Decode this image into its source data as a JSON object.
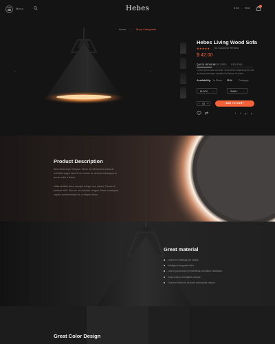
{
  "header": {
    "menu_label": "Menu",
    "brand": "Hebes",
    "links": [
      "$ EN",
      "ENG"
    ],
    "cart_icon": "bag-icon",
    "search_icon": "search-icon",
    "menu_icon": "hamburger-icon"
  },
  "breadcrumb": {
    "home": "Home",
    "separator": "—",
    "current": "Shop Categories"
  },
  "gallery": {
    "prev_icon": "arrow-left-icon",
    "next_icon": "arrow-right-icon",
    "thumbnail_count": 4
  },
  "product": {
    "title": "Hebes Living Wood Sofa",
    "stars": "★★★★★",
    "rating": 5,
    "reviews": "03 Customer Review",
    "price": "$ 42.00",
    "tabs": [
      "QUICK REVIEW",
      "FEATURES",
      "REVIEWS"
    ],
    "active_tab": 0,
    "description": "Lorem ipsum dolor sit amet, consectetur adipiscing elit, sed do eiusmod tempor incididunt ut labore et dolore.",
    "availability_label": "Availability:",
    "availability_options": [
      "In Stock",
      "SKU:",
      "Category"
    ],
    "selected_availability": 1,
    "color_select": "BLACK",
    "size_select": "SMALL",
    "qty": {
      "minus": "−",
      "value": "03",
      "plus": "+"
    },
    "add_to_cart": "ADD TO CART",
    "share_icons": [
      "f",
      "t",
      "g+",
      "p"
    ]
  },
  "description_section": {
    "title": "Product Description",
    "para1": "Sed ullamcorper tempus. Risus et velit laoreet placerat molestie augue laoreet ex cursus ut, aenean consequat ut auctor nibh a lectus.",
    "para2": "Nulla facilisis lacus suscipit integer nec rutrum. Donec id pretium nibh. Duis ac ex ut lectus congue, fusce consequat sapien cursus tempor et, ut aliquet dolor."
  },
  "material_section": {
    "title": "Great material",
    "bullets": [
      "Lorem in Chaebigs per Vitaes",
      "Intelligent integrated tabs",
      "Lorem ipsum super percentibus intentibus vestibulus",
      "Vitae pretium intelligenti suesae",
      "Lorem et libero mi sit amet anciscenta culmus"
    ]
  },
  "color_section": {
    "title": "Great Color Design"
  },
  "colors": {
    "accent": "#f4623a",
    "background": "#141414",
    "text": "#f2f2f2"
  }
}
